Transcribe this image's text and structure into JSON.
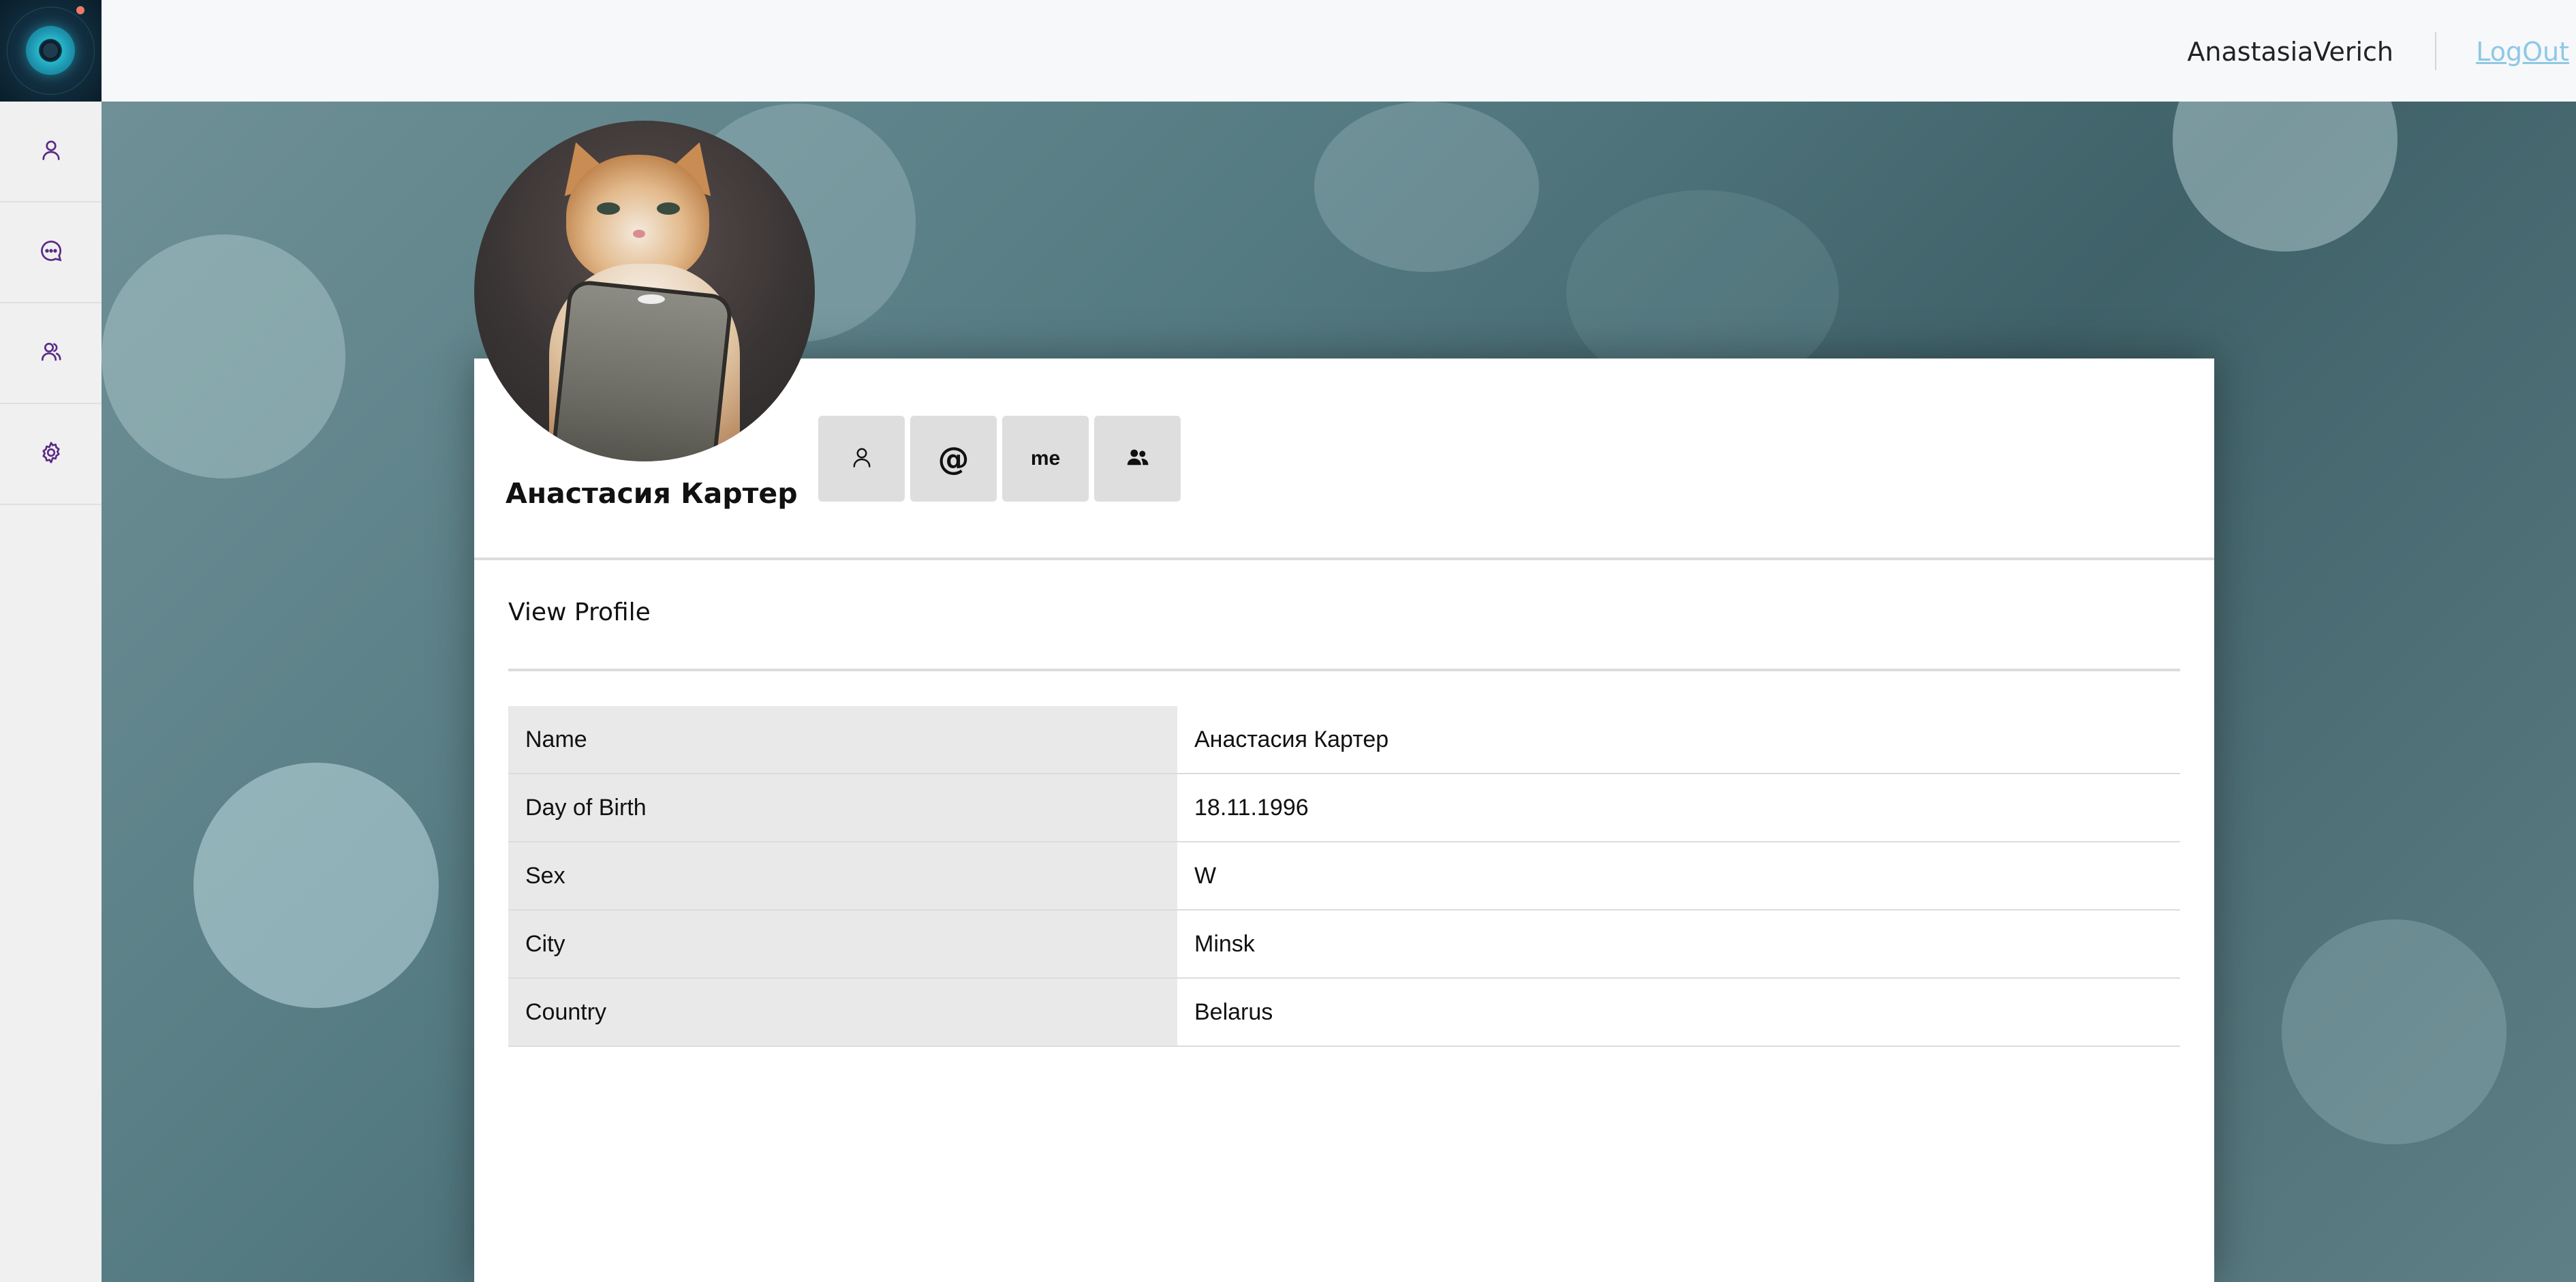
{
  "header": {
    "username": "AnastasiaVerich",
    "logout_label": "LogOut"
  },
  "sidebar": {
    "items": [
      {
        "icon": "user-icon"
      },
      {
        "icon": "chat-icon"
      },
      {
        "icon": "friends-icon"
      },
      {
        "icon": "gear-icon"
      }
    ]
  },
  "profile": {
    "name": "Анастасия Картер",
    "actions": [
      {
        "icon": "user-icon"
      },
      {
        "icon": "at-icon",
        "text": "@"
      },
      {
        "icon": "me-icon",
        "text": "me"
      },
      {
        "icon": "users-icon"
      }
    ]
  },
  "view_profile": {
    "title": "View Profile",
    "rows": [
      {
        "label": "Name",
        "value": "Анастасия Картер"
      },
      {
        "label": "Day of Birth",
        "value": "18.11.1996"
      },
      {
        "label": "Sex",
        "value": "W"
      },
      {
        "label": "City",
        "value": "Minsk"
      },
      {
        "label": "Country",
        "value": "Belarus"
      }
    ]
  },
  "colors": {
    "accent_icon": "#5a2a87",
    "logout_link": "#8fc8e4",
    "logo_dot": "#f07a68"
  }
}
